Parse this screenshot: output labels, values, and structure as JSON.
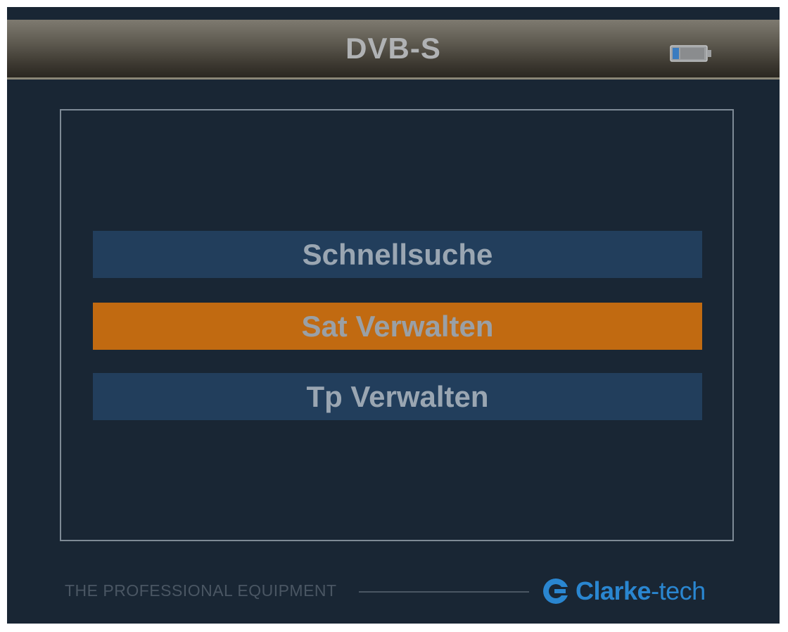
{
  "header": {
    "title": "DVB-S",
    "battery_icon": "battery-icon"
  },
  "menu": {
    "items": [
      {
        "label": "Schnellsuche",
        "selected": false
      },
      {
        "label": "Sat Verwalten",
        "selected": true
      },
      {
        "label": "Tp Verwalten",
        "selected": false
      }
    ]
  },
  "footer": {
    "tagline": "THE PROFESSIONAL EQUIPMENT",
    "brand_strong": "Clarke",
    "brand_light": "-tech",
    "logo_icon": "clarke-tech-logo-icon"
  },
  "colors": {
    "background": "#192634",
    "menu_item": "#223e5c",
    "menu_item_selected": "#c16a11",
    "brand": "#2a86d0"
  }
}
